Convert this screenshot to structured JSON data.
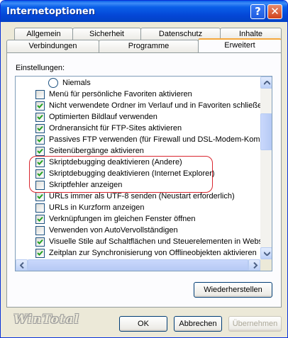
{
  "window": {
    "title": "Internetoptionen",
    "help_label": "?",
    "close_label": "✕"
  },
  "tabs": {
    "row_back": [
      "Allgemein",
      "Sicherheit",
      "Datenschutz",
      "Inhalte"
    ],
    "row_front": [
      "Verbindungen",
      "Programme",
      "Erweitert"
    ],
    "active": "Erweitert"
  },
  "settings": {
    "label": "Einstellungen:",
    "items": [
      {
        "kind": "radio",
        "label": "Niemals",
        "checked": false
      },
      {
        "kind": "checkbox",
        "label": "Menü für persönliche Favoriten aktivieren",
        "checked": false
      },
      {
        "kind": "checkbox",
        "label": "Nicht verwendete Ordner im Verlauf und in Favoriten schließen",
        "checked": true
      },
      {
        "kind": "checkbox",
        "label": "Optimierten Bildlauf verwenden",
        "checked": true
      },
      {
        "kind": "checkbox",
        "label": "Ordneransicht für FTP-Sites aktivieren",
        "checked": true
      },
      {
        "kind": "checkbox",
        "label": "Passives FTP verwenden (für Firewall und DSL-Modem-Kompatibilität)",
        "checked": true
      },
      {
        "kind": "checkbox",
        "label": "Seitenübergänge aktivieren",
        "checked": true
      },
      {
        "kind": "checkbox",
        "label": "Skriptdebugging deaktivieren (Andere)",
        "checked": true
      },
      {
        "kind": "checkbox",
        "label": "Skriptdebugging deaktivieren (Internet Explorer)",
        "checked": true
      },
      {
        "kind": "checkbox",
        "label": "Skriptfehler anzeigen",
        "checked": false
      },
      {
        "kind": "checkbox",
        "label": "URLs immer als UTF-8 senden (Neustart erforderlich)",
        "checked": true
      },
      {
        "kind": "checkbox",
        "label": "URLs in Kurzform anzeigen",
        "checked": false
      },
      {
        "kind": "checkbox",
        "label": "Verknüpfungen im gleichen Fenster öffnen",
        "checked": true
      },
      {
        "kind": "checkbox",
        "label": "Verwenden von AutoVervollständigen",
        "checked": false
      },
      {
        "kind": "checkbox",
        "label": "Visuelle Stile auf Schaltflächen und Steuerelementen in Webseiten",
        "checked": true
      },
      {
        "kind": "checkbox",
        "label": "Zeitplan zur Synchronisierung von Offlineobjekten aktivieren",
        "checked": true
      }
    ]
  },
  "buttons": {
    "restore": "Wiederherstellen",
    "ok": "OK",
    "cancel": "Abbrechen",
    "apply": "Übernehmen"
  },
  "watermark": "WinTotal",
  "colors": {
    "titlebar": "#0a5fe9",
    "checkmark": "#21a121",
    "highlight": "#d9262f",
    "active_tab": "#f5a73b"
  }
}
